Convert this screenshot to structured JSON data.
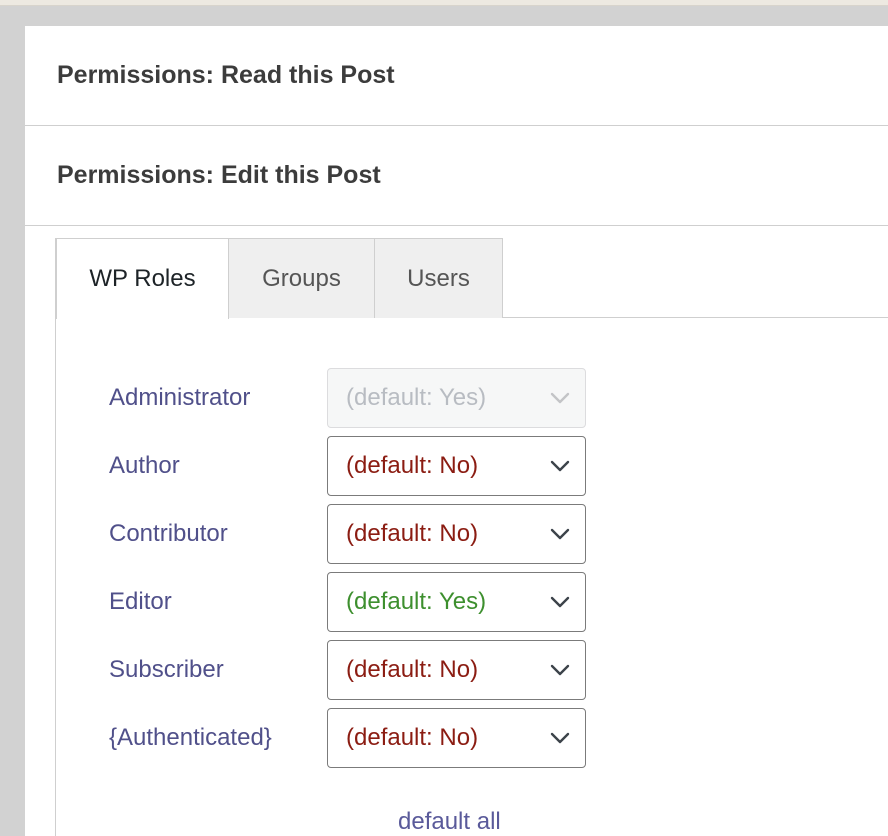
{
  "sections": {
    "read_title": "Permissions: Read this Post",
    "edit_title": "Permissions: Edit this Post"
  },
  "tabs": [
    {
      "label": "WP Roles",
      "active": true
    },
    {
      "label": "Groups",
      "active": false
    },
    {
      "label": "Users",
      "active": false
    }
  ],
  "roles": [
    {
      "label": "Administrator",
      "value": "(default: Yes)",
      "state": "disabled"
    },
    {
      "label": "Author",
      "value": "(default: No)",
      "state": "no"
    },
    {
      "label": "Contributor",
      "value": "(default: No)",
      "state": "no"
    },
    {
      "label": "Editor",
      "value": "(default: Yes)",
      "state": "yes"
    },
    {
      "label": "Subscriber",
      "value": "(default: No)",
      "state": "no"
    },
    {
      "label": "{Authenticated}",
      "value": "(default: No)",
      "state": "no"
    }
  ],
  "default_all_label": "default all",
  "colors": {
    "no": "#8b1c12",
    "yes": "#3d8f2e",
    "label": "#50508a",
    "disabled": "#b8bcc2"
  },
  "icons": {
    "select_arrow": "chevron-down-icon"
  }
}
